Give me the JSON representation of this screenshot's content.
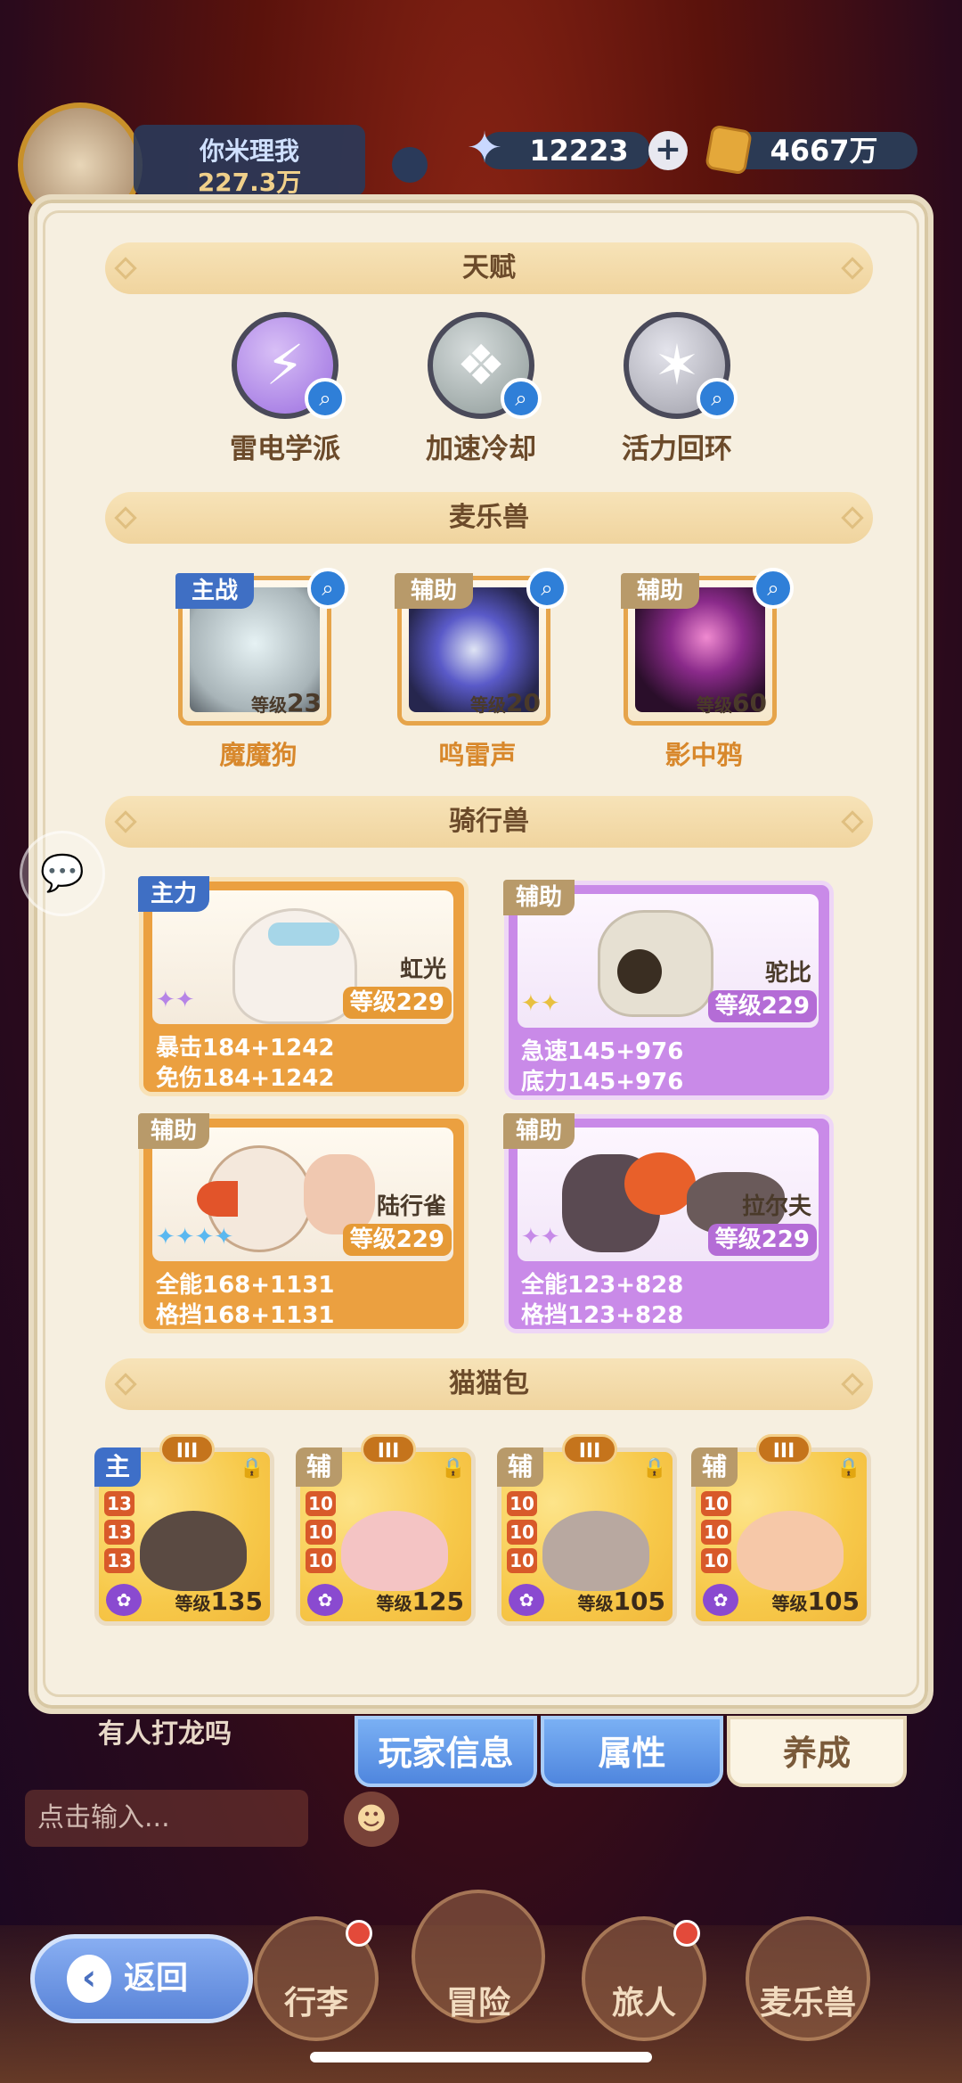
{
  "header": {
    "player_name": "你米理我",
    "player_power": "227.3万",
    "gems": "12223",
    "gold": "4667万",
    "icons": {
      "gem": "star-crystal-icon",
      "gold": "gold-coin-icon",
      "add": "plus-icon"
    }
  },
  "sections": {
    "talent": "天赋",
    "pets": "麦乐兽",
    "mounts": "骑行兽",
    "cats": "猫猫包"
  },
  "talents": [
    {
      "label": "雷电学派",
      "color": "#b58ce6",
      "glyph": "⚡"
    },
    {
      "label": "加速冷却",
      "color": "#a6b2b0",
      "glyph": "✦"
    },
    {
      "label": "活力回环",
      "color": "#b8b8c4",
      "glyph": "✶"
    }
  ],
  "pets": [
    {
      "name": "魔魔狗",
      "tag": "主战",
      "level_label": "等级",
      "level": "23",
      "tag_color": "#3f6fc4",
      "art": "#c8d4d8"
    },
    {
      "name": "鸣雷声",
      "tag": "辅助",
      "level_label": "等级",
      "level": "20",
      "tag_color": "#b89a6a",
      "art": "#3a3a8a"
    },
    {
      "name": "影中鸦",
      "tag": "辅助",
      "level_label": "等级",
      "level": "60",
      "tag_color": "#b89a6a",
      "art": "#3a1a3a"
    }
  ],
  "mounts": [
    {
      "name": "虹光",
      "tag": "主力",
      "level": "等级229",
      "stat1": "暴击184+1242",
      "stat2": "免伤184+1242",
      "theme": "orange",
      "stars": "✦✦"
    },
    {
      "name": "驼比",
      "tag": "辅助",
      "level": "等级229",
      "stat1": "急速145+976",
      "stat2": "底力145+976",
      "theme": "purple",
      "stars": "✦✦"
    },
    {
      "name": "陆行雀",
      "tag": "辅助",
      "level": "等级229",
      "stat1": "全能168+1131",
      "stat2": "格挡168+1131",
      "theme": "orange",
      "stars": "✦✦✦✦"
    },
    {
      "name": "拉尔夫",
      "tag": "辅助",
      "level": "等级229",
      "stat1": "全能123+828",
      "stat2": "格挡123+828",
      "theme": "purple",
      "stars": "✦✦"
    }
  ],
  "cats": [
    {
      "tag": "主",
      "tier": "III",
      "nums": [
        "13",
        "13",
        "13"
      ],
      "level_label": "等级",
      "level": "135",
      "face": "#5a4a42"
    },
    {
      "tag": "辅",
      "tier": "III",
      "nums": [
        "10",
        "10",
        "10"
      ],
      "level_label": "等级",
      "level": "125",
      "face": "#f4c4c4"
    },
    {
      "tag": "辅",
      "tier": "III",
      "nums": [
        "10",
        "10",
        "10"
      ],
      "level_label": "等级",
      "level": "105",
      "face": "#b8a8a0"
    },
    {
      "tag": "辅",
      "tier": "III",
      "nums": [
        "10",
        "10",
        "10"
      ],
      "level_label": "等级",
      "level": "105",
      "face": "#f6c8a8"
    }
  ],
  "tabs": [
    {
      "label": "玩家信息",
      "active": false
    },
    {
      "label": "属性",
      "active": false
    },
    {
      "label": "养成",
      "active": true
    }
  ],
  "chat": {
    "message": "有人打龙吗",
    "input_placeholder": "点击输入..."
  },
  "nav": [
    {
      "label": "行李",
      "dot": true
    },
    {
      "label": "冒险",
      "dot": false
    },
    {
      "label": "旅人",
      "dot": true
    },
    {
      "label": "麦乐兽",
      "dot": false
    }
  ],
  "back_label": "返回"
}
